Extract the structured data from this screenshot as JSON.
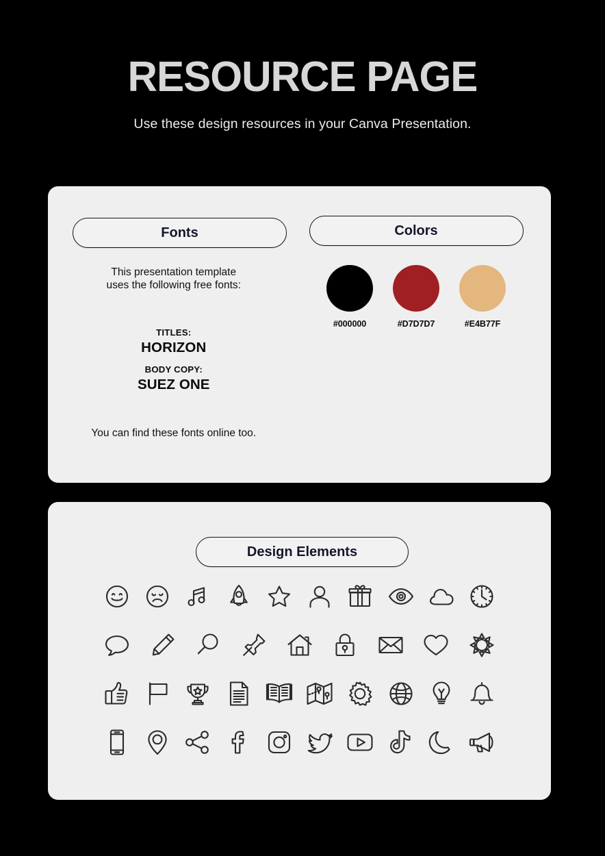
{
  "header": {
    "title": "RESOURCE PAGE",
    "subtitle": "Use these design resources in your Canva Presentation.",
    "title_color": "#D7D7D7",
    "background_color": "#000000"
  },
  "panels": {
    "fonts": {
      "pill_label": "Fonts",
      "intro_line1": "This presentation template",
      "intro_line2": "uses the following free fonts:",
      "titles_kind": "TITLES:",
      "titles_font": "HORIZON",
      "body_kind": "BODY COPY:",
      "body_font": "SUEZ ONE",
      "footer": "You can find these fonts online too.",
      "panel_color": "#EFEFEF"
    },
    "colors": {
      "pill_label": "Colors",
      "swatches": [
        {
          "label": "#000000",
          "swatch_color": "#000000"
        },
        {
          "label": "#D7D7D7",
          "swatch_color": "#A01F22"
        },
        {
          "label": "#E4B77F",
          "swatch_color": "#E4B77F"
        }
      ]
    },
    "elements": {
      "pill_label": "Design Elements",
      "rows": [
        [
          {
            "icon": "smiley-face-icon"
          },
          {
            "icon": "sad-face-icon"
          },
          {
            "icon": "music-note-icon"
          },
          {
            "icon": "rocket-icon"
          },
          {
            "icon": "star-icon"
          },
          {
            "icon": "person-icon"
          },
          {
            "icon": "gift-icon"
          },
          {
            "icon": "eye-icon"
          },
          {
            "icon": "cloud-icon"
          },
          {
            "icon": "clock-icon"
          }
        ],
        [
          {
            "icon": "speech-bubble-icon"
          },
          {
            "icon": "pencil-icon"
          },
          {
            "icon": "magnifier-icon"
          },
          {
            "icon": "pushpin-icon"
          },
          {
            "icon": "house-icon"
          },
          {
            "icon": "padlock-icon"
          },
          {
            "icon": "envelope-icon"
          },
          {
            "icon": "heart-icon"
          },
          {
            "icon": "sun-icon"
          }
        ],
        [
          {
            "icon": "thumbs-up-icon"
          },
          {
            "icon": "flag-icon"
          },
          {
            "icon": "trophy-icon"
          },
          {
            "icon": "document-icon"
          },
          {
            "icon": "open-book-icon"
          },
          {
            "icon": "map-icon"
          },
          {
            "icon": "gear-icon"
          },
          {
            "icon": "globe-icon"
          },
          {
            "icon": "lightbulb-icon"
          },
          {
            "icon": "bell-icon"
          }
        ],
        [
          {
            "icon": "smartphone-icon"
          },
          {
            "icon": "location-pin-icon"
          },
          {
            "icon": "share-icon"
          },
          {
            "icon": "facebook-icon"
          },
          {
            "icon": "instagram-icon"
          },
          {
            "icon": "twitter-icon"
          },
          {
            "icon": "youtube-icon"
          },
          {
            "icon": "tiktok-icon"
          },
          {
            "icon": "moon-icon"
          },
          {
            "icon": "megaphone-icon"
          }
        ]
      ]
    }
  }
}
